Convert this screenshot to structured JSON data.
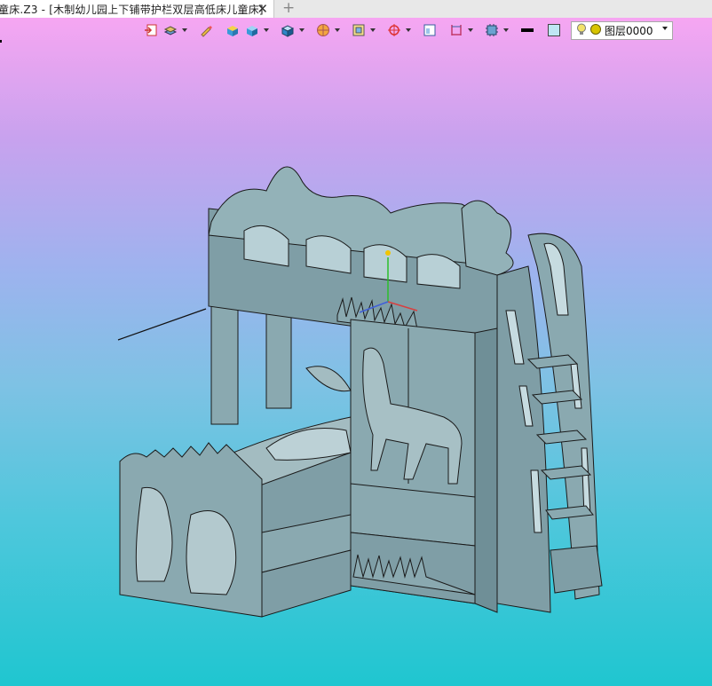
{
  "document": {
    "tab_title": "童床.Z3 - [木制幼儿园上下铺带护栏双层高低床儿童床]",
    "tab_close": "✕",
    "tab_add": "+"
  },
  "toolbar": {
    "buttons": [
      {
        "icon": "import-icon",
        "dropdown": false
      },
      {
        "icon": "stack-icon",
        "dropdown": true
      },
      {
        "icon": "pencil-icon",
        "dropdown": false
      },
      {
        "icon": "solid-box-icon",
        "dropdown": false
      },
      {
        "icon": "cube-shaded-icon",
        "dropdown": true
      },
      {
        "icon": "cube-view-icon",
        "dropdown": true
      },
      {
        "icon": "sphere-render-icon",
        "dropdown": true
      },
      {
        "icon": "frame-view-icon",
        "dropdown": true
      },
      {
        "icon": "target-icon",
        "dropdown": true
      },
      {
        "icon": "window-icon",
        "dropdown": false
      },
      {
        "icon": "dimension-icon",
        "dropdown": true
      },
      {
        "icon": "chip-icon",
        "dropdown": true
      },
      {
        "icon": "line-weight-icon",
        "dropdown": false
      },
      {
        "icon": "color-swatch-icon",
        "dropdown": false
      },
      {
        "icon": "layer-stack-icon",
        "dropdown": true
      }
    ],
    "layer_select": {
      "value": "图层0000",
      "bulb_color": "#f2e26a",
      "sun_color": "#d8c400"
    }
  },
  "viewport": {
    "gradient_top": "#f6a6f2",
    "gradient_bottom": "#1fc6d0",
    "model_fill": "#8aa9b0",
    "model_stroke": "#1a1a1a"
  }
}
